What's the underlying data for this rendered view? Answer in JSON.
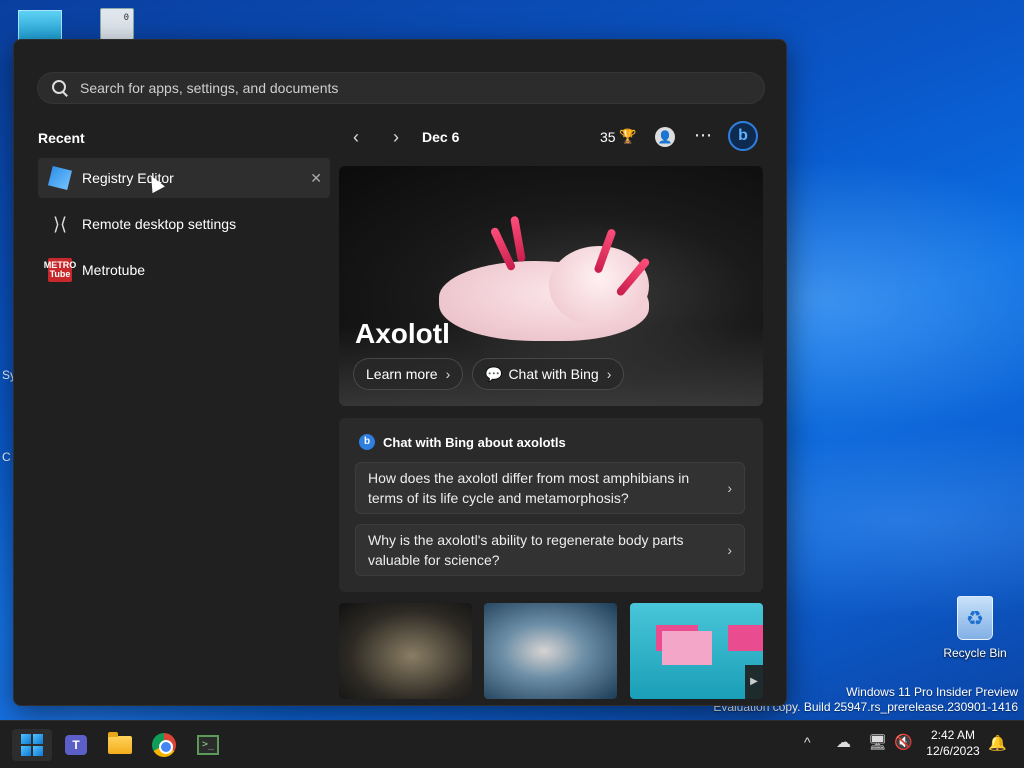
{
  "desktop": {
    "recycle_bin_label": "Recycle Bin",
    "watermark_line1": "Windows 11 Pro Insider Preview",
    "watermark_line2": "Evaluation copy. Build 25947.rs_prerelease.230901-1416",
    "edge_text_1": "Sy",
    "edge_text_2": "C"
  },
  "start_menu": {
    "search": {
      "placeholder": "Search for apps, settings, and documents",
      "value": ""
    },
    "recent": {
      "title": "Recent",
      "items": [
        {
          "label": "Registry Editor",
          "icon": "registry-editor-icon",
          "close": "✕"
        },
        {
          "label": "Remote desktop settings",
          "icon": "remote-desktop-icon"
        },
        {
          "label": "Metrotube",
          "icon": "metrotube-icon",
          "icon_top": "METRO",
          "icon_bottom": "Tube"
        }
      ]
    },
    "feed": {
      "date": "Dec 6",
      "points": "35",
      "hero": {
        "title": "Axolotl",
        "learn_more": "Learn more",
        "chat_with_bing": "Chat with Bing"
      },
      "chat_card": {
        "title": "Chat with Bing about axolotls",
        "questions": [
          "How does the axolotl differ from most amphibians in terms of its life cycle and metamorphosis?",
          "Why is the axolotl's ability to regenerate body parts valuable for science?"
        ]
      }
    }
  },
  "taskbar": {
    "time": "2:42 AM",
    "date": "12/6/2023"
  },
  "colors": {
    "start_bg": "#202020",
    "accent": "#2f7fe0",
    "taskbar_bg": "#1f1f1f"
  }
}
